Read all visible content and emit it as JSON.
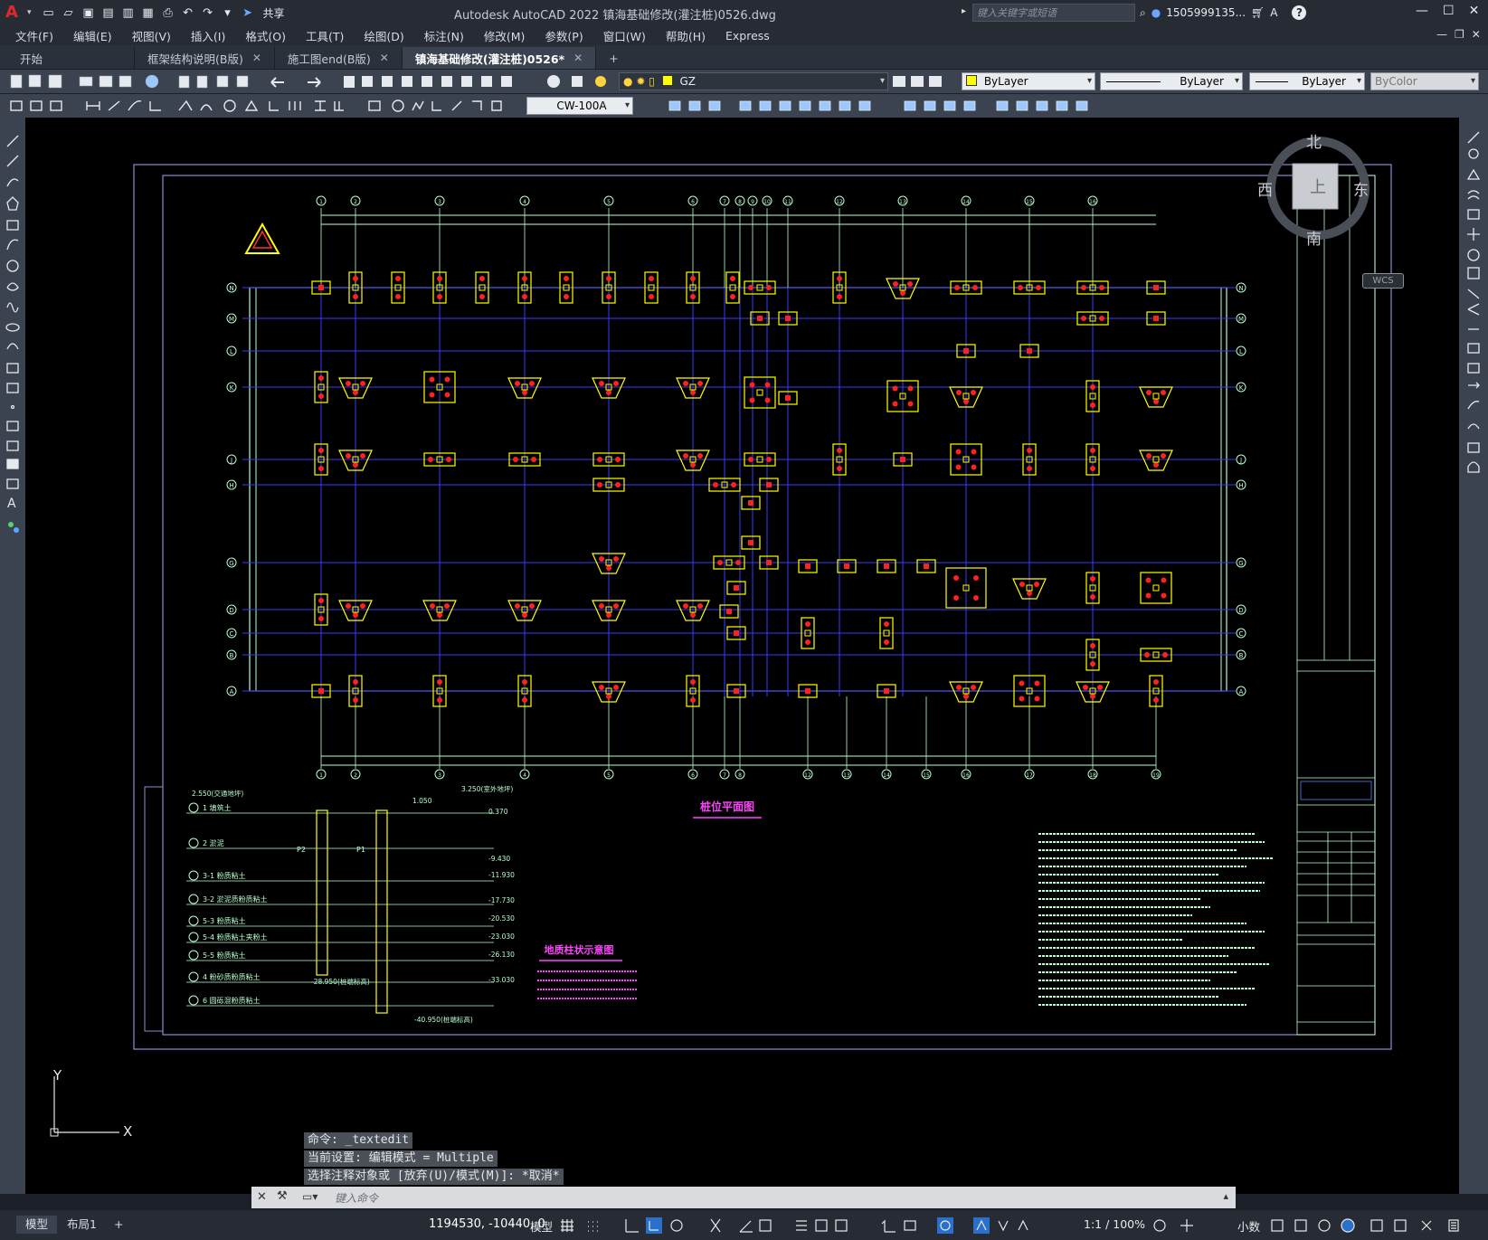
{
  "titlebar": {
    "app_title": "Autodesk AutoCAD 2022    镇海基础修改(灌注桩)0526.dwg",
    "share_label": "共享",
    "search_placeholder": "键入关键字或短语",
    "user_name": "1505999135...",
    "help_label": "?"
  },
  "menu": [
    "文件(F)",
    "编辑(E)",
    "视图(V)",
    "插入(I)",
    "格式(O)",
    "工具(T)",
    "绘图(D)",
    "标注(N)",
    "修改(M)",
    "参数(P)",
    "窗口(W)",
    "帮助(H)",
    "Express"
  ],
  "tabs": [
    {
      "label": "开始"
    },
    {
      "label": "框架结构说明(B版)"
    },
    {
      "label": "施工图end(B版)"
    },
    {
      "label": "镇海基础修改(灌注桩)0526*"
    }
  ],
  "toolbar": {
    "layer_combo": "GZ",
    "color_combo": "ByLayer",
    "linetype_combo": "ByLayer",
    "lineweight_combo": "ByLayer",
    "plotstyle_combo": "ByColor",
    "dimstyle_combo": "CW-100A"
  },
  "viewcube": {
    "north": "北",
    "south": "南",
    "east": "东",
    "west": "西",
    "top": "上",
    "wcs": "WCS"
  },
  "drawing": {
    "grid_top": [
      "1",
      "2",
      "3",
      "4",
      "5",
      "6",
      "7",
      "8",
      "9",
      "10",
      "11",
      "12",
      "13",
      "14",
      "15",
      "16"
    ],
    "grid_bottom": [
      "1",
      "2",
      "3",
      "4",
      "5",
      "6",
      "7",
      "8",
      "12",
      "13",
      "14",
      "15",
      "16",
      "17",
      "18",
      "19"
    ],
    "grid_left": [
      "N",
      "M",
      "L",
      "K",
      "J",
      "H",
      "G",
      "D",
      "C",
      "B",
      "A"
    ],
    "plan_title": "桩位平面图",
    "geo_title": "地质柱状示意图",
    "layers": [
      {
        "num": "1",
        "name": "填筑土"
      },
      {
        "num": "2",
        "name": "淤泥"
      },
      {
        "num": "3-1",
        "name": "粉质粘土"
      },
      {
        "num": "3-2",
        "name": "淤泥质粉质粘土"
      },
      {
        "num": "5-3",
        "name": "粉质粘土"
      },
      {
        "num": "5-4",
        "name": "粉质粘土夹粉土"
      },
      {
        "num": "5-5",
        "name": "粉质粘土"
      },
      {
        "num": "4",
        "name": "粉砂质粉质粘土"
      },
      {
        "num": "6",
        "name": "圆砾混粉质粘土"
      }
    ],
    "elevations": [
      "3.250(室外地坪)",
      "0.370",
      "-9.430",
      "-11.930",
      "-17.730",
      "-20.530",
      "-23.030",
      "-26.130",
      "-33.030",
      "-40.950(桩端标高)",
      "-28.950(桩端标高)",
      "2.550(交通地坪)",
      "1.050"
    ],
    "pile_labels": {
      "p2": "P2",
      "p1": "P1"
    }
  },
  "command": {
    "line1": "命令: _textedit",
    "line2": "当前设置: 编辑模式 = Multiple",
    "line3": "选择注释对象或 [放弃(U)/模式(M)]: *取消*",
    "placeholder": "键入命令"
  },
  "statusbar": {
    "tab_model": "模型",
    "tab_layout": "布局1",
    "add": "+",
    "coords": "1194530, -10440, 0",
    "model_label": "模型",
    "scale": "1:1 / 100%",
    "units": "小数"
  },
  "ucs": {
    "x": "X",
    "y": "Y"
  },
  "colors": {
    "accent": "#2a6fc9",
    "grid_axis": "#3a3aff",
    "pile": "#ffff00",
    "pile_fill": "#ff2020",
    "dim": "#b8ffd0",
    "magenta": "#ff44ff",
    "frame": "#8c8cd8"
  }
}
